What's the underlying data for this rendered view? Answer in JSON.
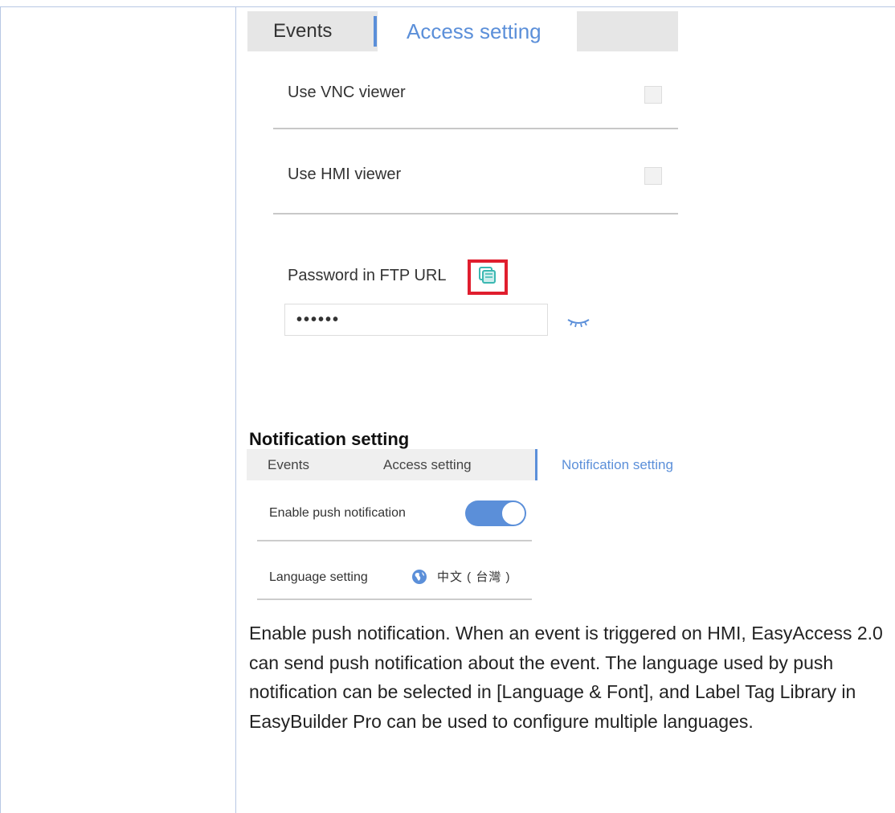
{
  "access_screenshot": {
    "tabs": {
      "events": "Events",
      "access": "Access setting"
    },
    "vnc_label": "Use VNC viewer",
    "hmi_label": "Use HMI viewer",
    "ftp_label": "Password in FTP URL",
    "password_value": "••••••"
  },
  "notification_heading": "Notification setting",
  "notification_screenshot": {
    "tabs": {
      "events": "Events",
      "access": "Access setting",
      "notification": "Notification setting"
    },
    "push_label": "Enable push notification",
    "push_enabled": true,
    "language_label": "Language setting",
    "language_value": "中文 ( 台灣 )"
  },
  "description": "Enable push notification. When an event is triggered on HMI, EasyAccess 2.0 can send push notification about the event. The language used by push notification can be selected in [Language & Font], and Label Tag Library in EasyBuilder Pro can be used to configure multiple languages.",
  "colors": {
    "accent": "#5b8fd9",
    "highlight": "#e01e2e",
    "copy_icon": "#3bb8b2"
  }
}
